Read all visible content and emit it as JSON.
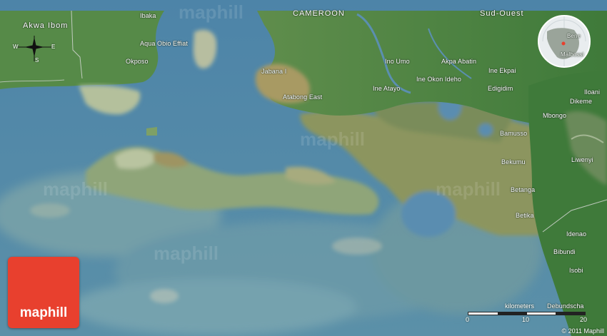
{
  "brand": {
    "logo_text": "maphill",
    "watermark": "maphill"
  },
  "copyright": "© 2011 Maphill",
  "compass": {
    "west": "W",
    "east": "E",
    "south": "S"
  },
  "scale": {
    "title": "kilometers",
    "ticks": [
      "0",
      "10",
      "20"
    ]
  },
  "globe_labels": {
    "a": "Bene",
    "b": "Malbossi"
  },
  "labels": [
    {
      "id": "akwa-ibom",
      "text": "Akwa Ibom",
      "kind": "region"
    },
    {
      "id": "ibaka",
      "text": "Ibaka",
      "kind": "place"
    },
    {
      "id": "cameroon",
      "text": "CAMEROON",
      "kind": "region"
    },
    {
      "id": "sud-ouest",
      "text": "Sud-Ouest",
      "kind": "region"
    },
    {
      "id": "aqua-obio-effiat",
      "text": "Aqua Obio Effiat",
      "kind": "place"
    },
    {
      "id": "okposo",
      "text": "Okposo",
      "kind": "place"
    },
    {
      "id": "jabana-i",
      "text": "Jabana I",
      "kind": "place"
    },
    {
      "id": "ino-umo",
      "text": "Ino Umo",
      "kind": "place"
    },
    {
      "id": "akpa-abatin",
      "text": "Akpa Abatin",
      "kind": "place"
    },
    {
      "id": "ine-okon-ideho",
      "text": "Ine Okon Ideho",
      "kind": "place"
    },
    {
      "id": "ine-ekpai",
      "text": "Ine Ekpai",
      "kind": "place"
    },
    {
      "id": "ine-atayo",
      "text": "Ine Atayo",
      "kind": "place"
    },
    {
      "id": "edigidim",
      "text": "Edigidim",
      "kind": "place"
    },
    {
      "id": "atabong-east",
      "text": "Atabong East",
      "kind": "place"
    },
    {
      "id": "iloani",
      "text": "Iloani",
      "kind": "place"
    },
    {
      "id": "dikeme",
      "text": "Dikeme",
      "kind": "place"
    },
    {
      "id": "mbongo",
      "text": "Mbongo",
      "kind": "place"
    },
    {
      "id": "bamusso",
      "text": "Bamusso",
      "kind": "place"
    },
    {
      "id": "liwenyi",
      "text": "Liwenyi",
      "kind": "place"
    },
    {
      "id": "bekumu",
      "text": "Bekumu",
      "kind": "place"
    },
    {
      "id": "betanga",
      "text": "Betanga",
      "kind": "place"
    },
    {
      "id": "betika",
      "text": "Betika",
      "kind": "place"
    },
    {
      "id": "idenao",
      "text": "Idenao",
      "kind": "place"
    },
    {
      "id": "bibundi",
      "text": "Bibundi",
      "kind": "place"
    },
    {
      "id": "isobi",
      "text": "Isobi",
      "kind": "place"
    },
    {
      "id": "debundscha",
      "text": "Debundscha",
      "kind": "place"
    }
  ],
  "colors": {
    "sea": "#4f86a8",
    "shallow": "#6f9aa6",
    "land": "#4e8a45",
    "land_light": "#8aa872",
    "mud": "#8f9a6a",
    "logo": "#e8402e"
  }
}
